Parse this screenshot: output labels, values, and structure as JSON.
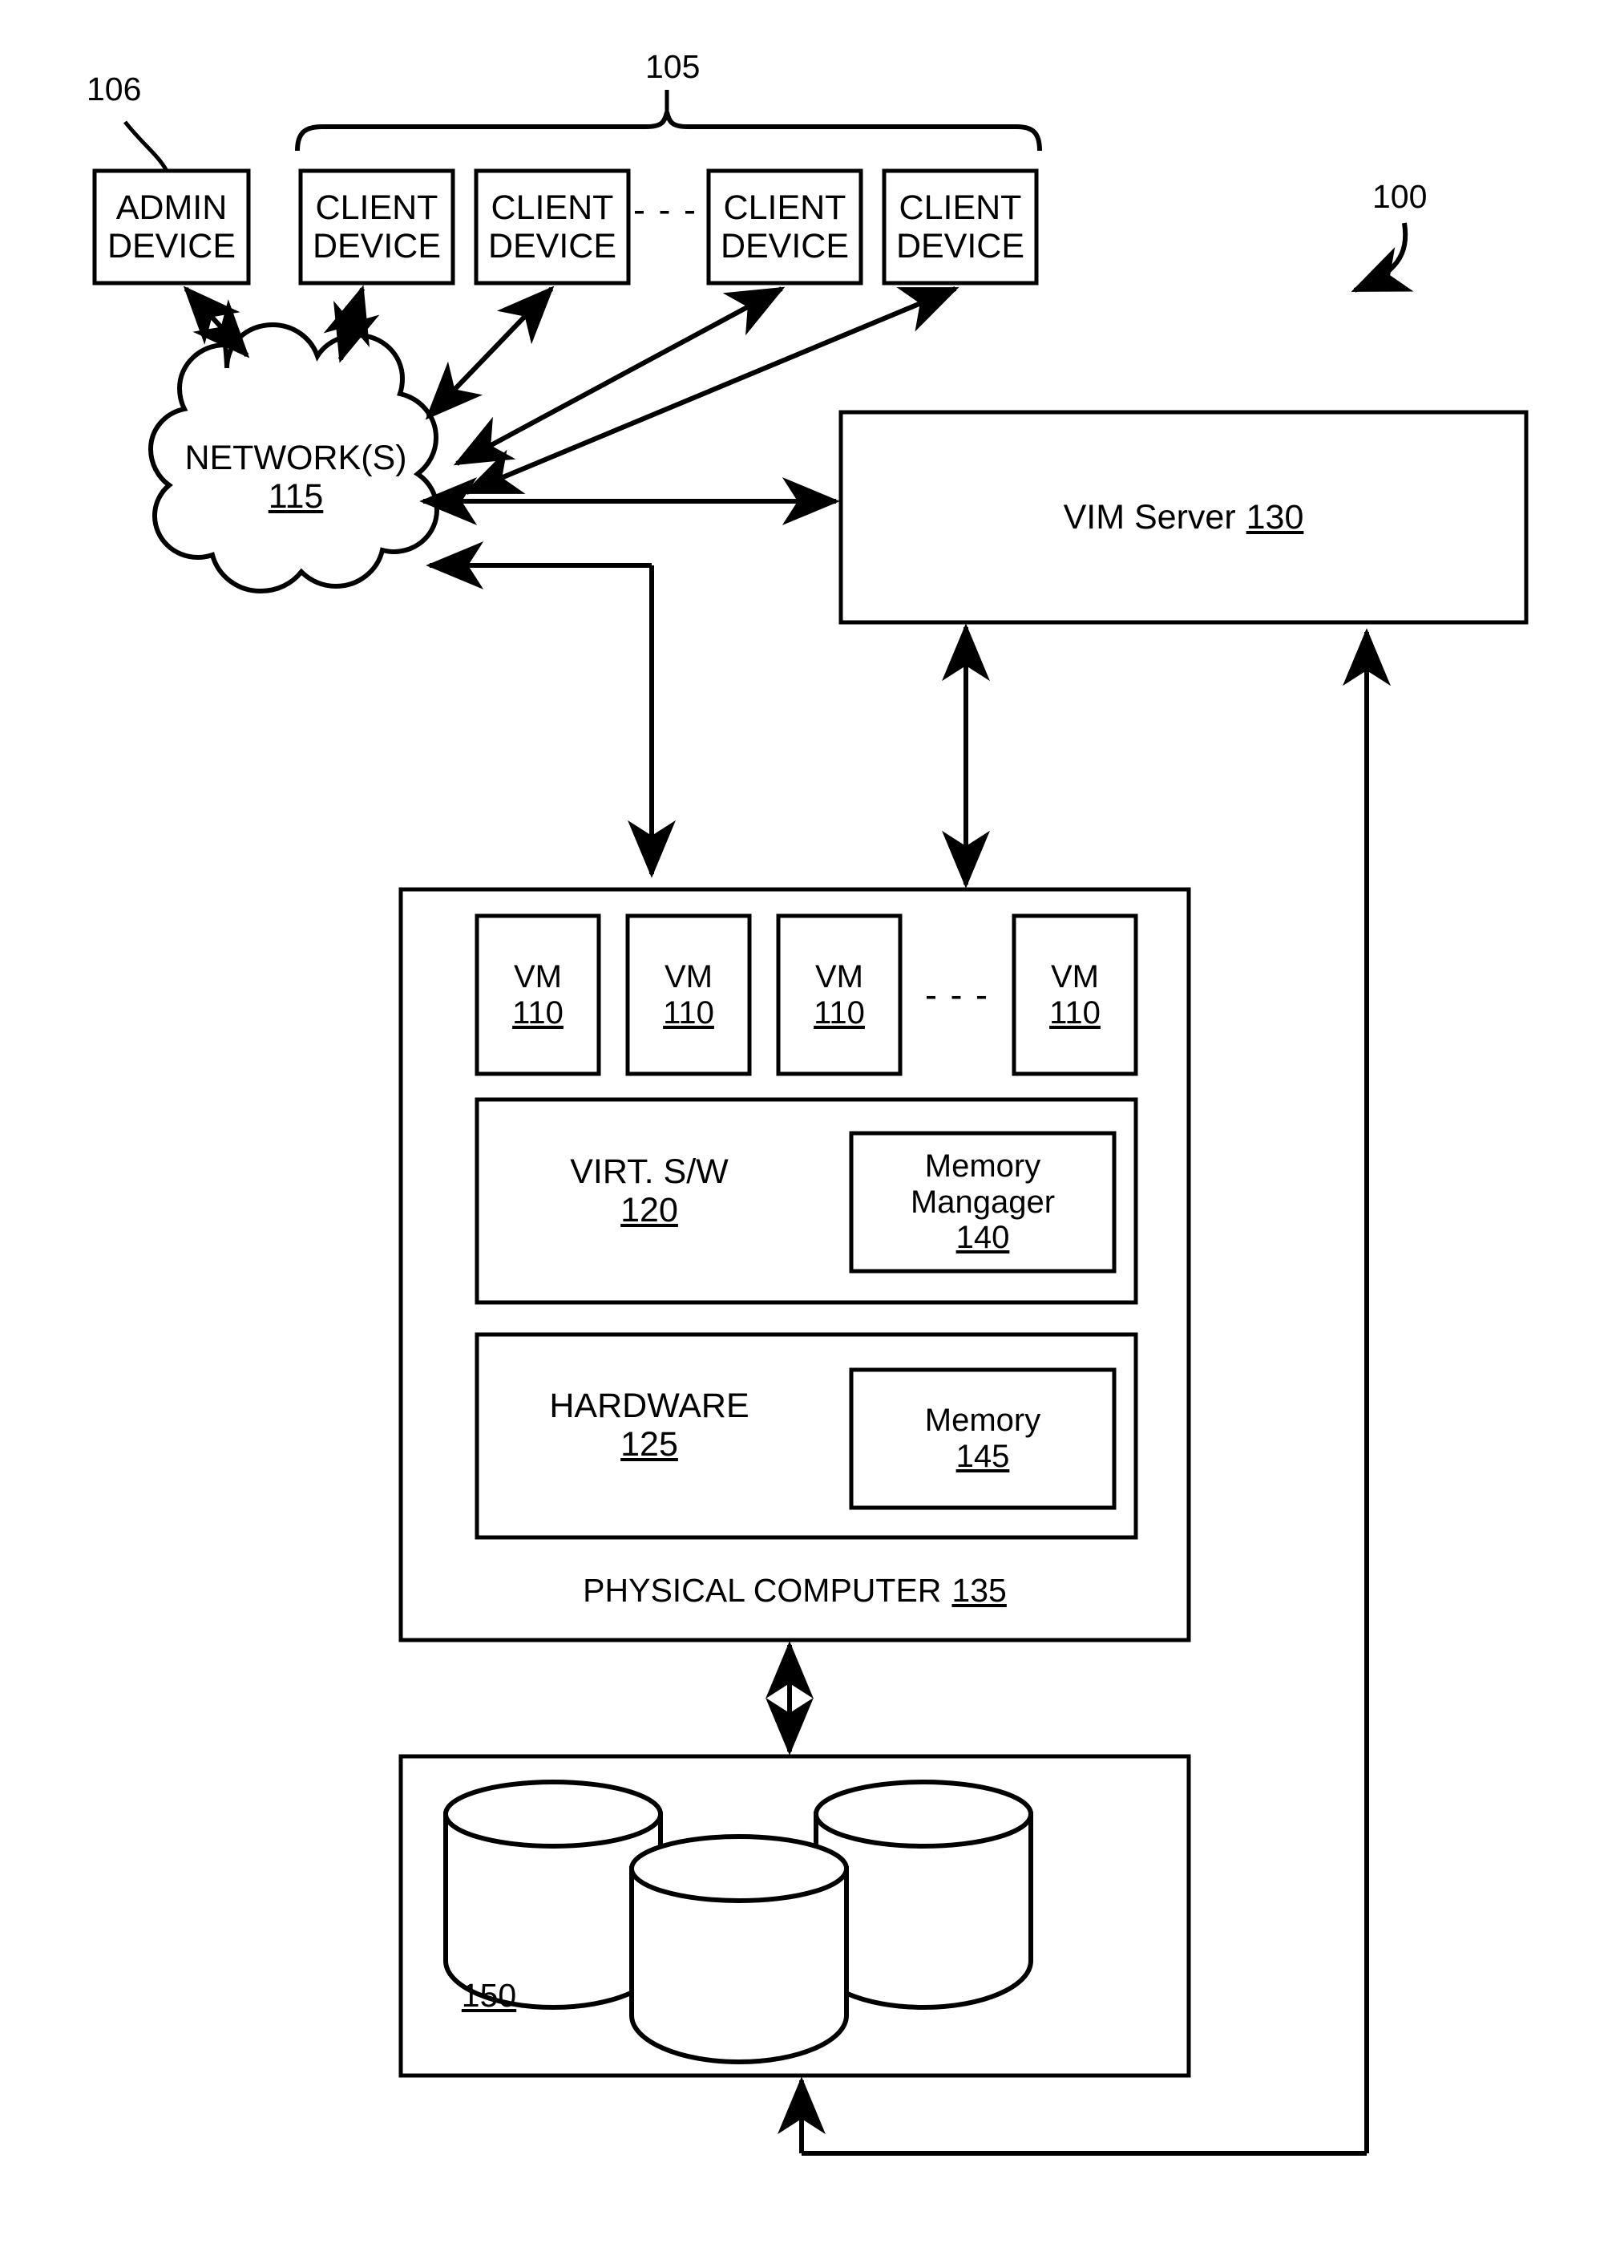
{
  "figure": {
    "type": "patent-block-diagram",
    "system_ref": "100",
    "admin_group_ref": "106",
    "client_group_ref": "105"
  },
  "callouts": {
    "system": "100",
    "admin": "106",
    "clients": "105"
  },
  "admin_device": {
    "line1": "ADMIN",
    "line2": "DEVICE"
  },
  "client_devices": [
    {
      "line1": "CLIENT",
      "line2": "DEVICE"
    },
    {
      "line1": "CLIENT",
      "line2": "DEVICE"
    },
    {
      "line1": "CLIENT",
      "line2": "DEVICE"
    },
    {
      "line1": "CLIENT",
      "line2": "DEVICE"
    }
  ],
  "client_ellipsis": "- - -",
  "network": {
    "label": "NETWORK(S)",
    "ref": "115"
  },
  "vim_server": {
    "label": "VIM Server",
    "ref": "130"
  },
  "physical_computer": {
    "label": "PHYSICAL COMPUTER",
    "ref": "135",
    "vms": [
      {
        "label": "VM",
        "ref": "110"
      },
      {
        "label": "VM",
        "ref": "110"
      },
      {
        "label": "VM",
        "ref": "110"
      },
      {
        "label": "VM",
        "ref": "110"
      }
    ],
    "vm_ellipsis": "- - -",
    "virt_sw": {
      "label": "VIRT. S/W",
      "ref": "120"
    },
    "memory_manager": {
      "line1": "Memory",
      "line2": "Mangager",
      "ref": "140"
    },
    "hardware": {
      "label": "HARDWARE",
      "ref": "125"
    },
    "memory": {
      "label": "Memory",
      "ref": "145"
    }
  },
  "storage": {
    "ref": "150",
    "cylinder_count": 3
  },
  "colors": {
    "stroke": "#000000",
    "background": "#ffffff"
  }
}
